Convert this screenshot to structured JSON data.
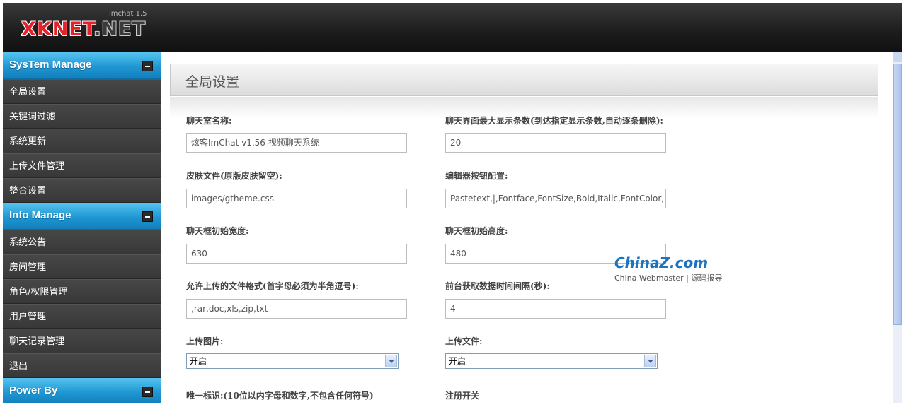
{
  "header": {
    "logo_text_1": "XKNET",
    "logo_text_2": ".NET",
    "logo_version": "imchat 1.5"
  },
  "sidebar": {
    "sections": [
      {
        "title": "SysTem Manage",
        "items": [
          "全局设置",
          "关键词过滤",
          "系统更新",
          "上传文件管理",
          "整合设置"
        ]
      },
      {
        "title": "Info Manage",
        "items": [
          "系统公告",
          "房间管理",
          "角色/权限管理",
          "用户管理",
          "聊天记录管理",
          "退出"
        ]
      },
      {
        "title": "Power By",
        "items": []
      }
    ]
  },
  "main": {
    "title": "全局设置",
    "fields": {
      "chatroom_name": {
        "label": "聊天室名称:",
        "value": "炫客ImChat v1.56 视频聊天系统"
      },
      "max_messages": {
        "label": "聊天界面最大显示条数(到达指定显示条数,自动逐条删除):",
        "value": "20"
      },
      "skin_file": {
        "label": "皮肤文件(原版皮肤留空):",
        "value": "images/gtheme.css"
      },
      "editor_buttons": {
        "label": "编辑器按钮配置:",
        "value": "Pastetext,|,Fontface,FontSize,Bold,Italic,FontColor,B"
      },
      "init_width": {
        "label": "聊天框初始宽度:",
        "value": "630"
      },
      "init_height": {
        "label": "聊天框初始高度:",
        "value": "480"
      },
      "upload_formats": {
        "label": "允许上传的文件格式(首字母必须为半角逗号):",
        "value": ",rar,doc,xls,zip,txt"
      },
      "fetch_interval": {
        "label": "前台获取数据时间间隔(秒):",
        "value": "4"
      },
      "upload_image": {
        "label": "上传图片:",
        "value": "开启"
      },
      "upload_file": {
        "label": "上传文件:",
        "value": "开启"
      },
      "unique_id": {
        "label": "唯一标识:(10位以内字母和数字,不包含任何符号)"
      },
      "register_switch": {
        "label": "注册开关"
      }
    }
  },
  "watermark": {
    "brand": "ChinaZ.com",
    "sub": "China Webmaster | 源码报导"
  }
}
